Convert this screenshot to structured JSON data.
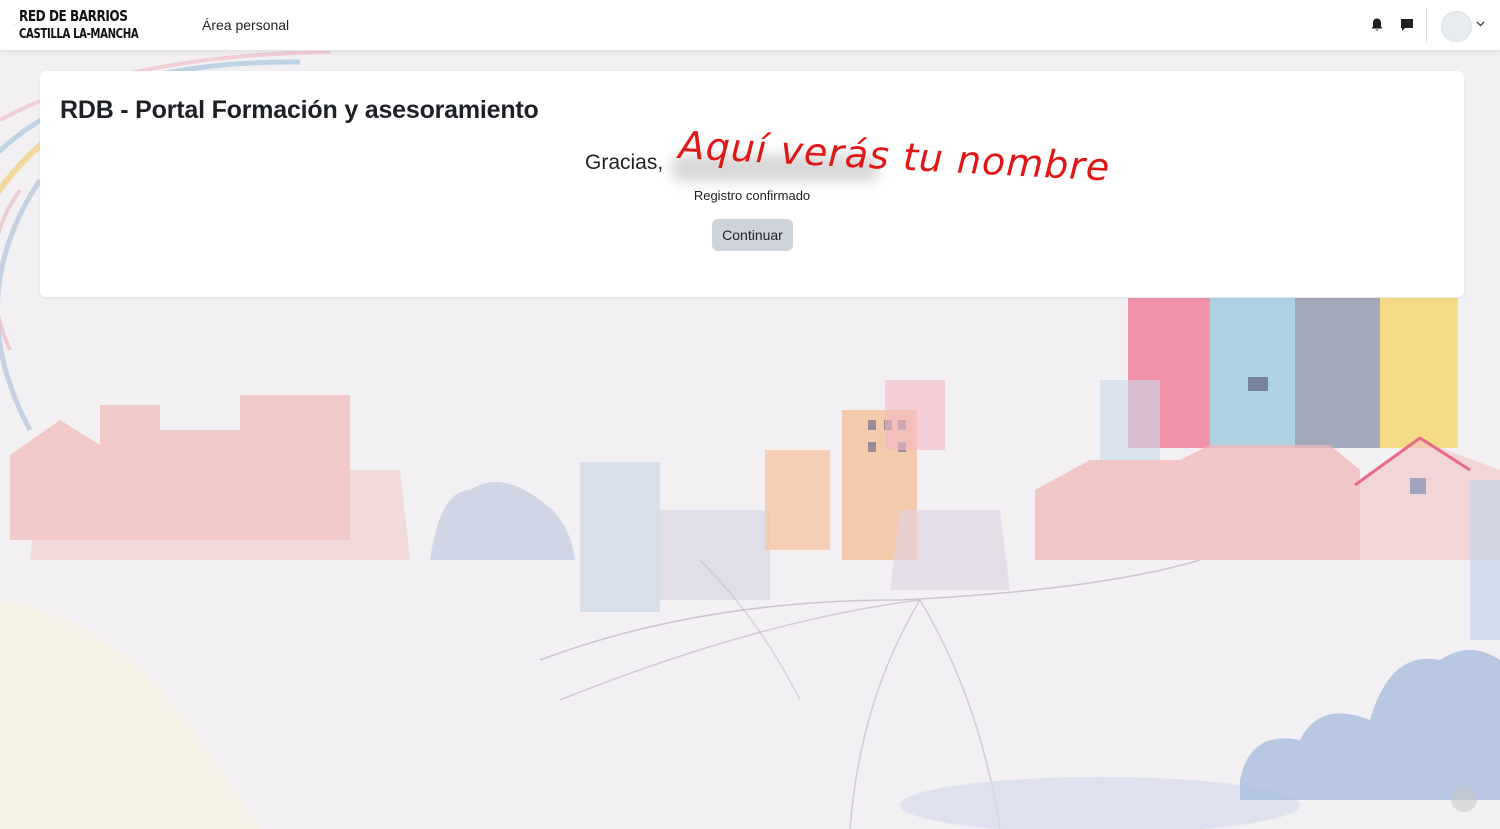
{
  "navbar": {
    "logo_line1": "RED DE BARRIOS",
    "logo_line2": "CASTILLA LA-MANCHA",
    "personal_area_link": "Área personal",
    "icons": [
      "bell-icon",
      "chat-icon",
      "avatar",
      "chevron-down-icon"
    ]
  },
  "card": {
    "title": "RDB - Portal Formación y asesoramiento",
    "greeting": "Gracias,",
    "name_placeholder": "Aquí verás tu nombre",
    "confirmation": "Registro confirmado",
    "continue_label": "Continuar"
  },
  "colors": {
    "accent_red": "#e01717",
    "button_bg": "#ced4da",
    "navbar_bg": "#ffffff"
  }
}
